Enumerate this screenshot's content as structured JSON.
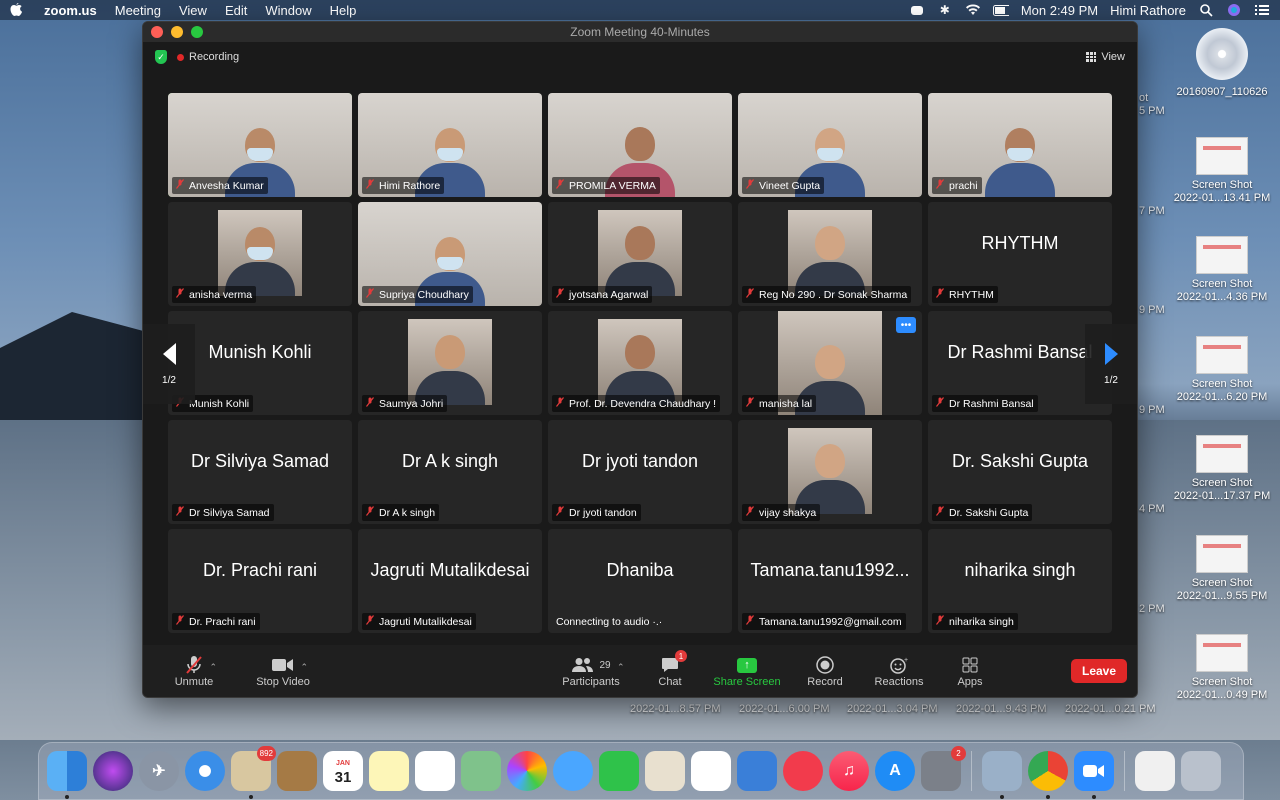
{
  "menubar": {
    "app": "zoom.us",
    "items": [
      "Meeting",
      "View",
      "Edit",
      "Window",
      "Help"
    ],
    "clock": "Mon 2:49 PM",
    "user": "Himi Rathore"
  },
  "window": {
    "title": "Zoom Meeting   40-Minutes",
    "recording": "Recording",
    "view_label": "View",
    "page_indicator": "1/2"
  },
  "participants": [
    {
      "name": "Anvesha Kumar",
      "display": "",
      "video": "masked",
      "active": true
    },
    {
      "name": "Himi Rathore",
      "display": "",
      "video": "masked",
      "active": false
    },
    {
      "name": "PROMILA VERMA",
      "display": "",
      "video": "person",
      "active": false
    },
    {
      "name": "Vineet Gupta",
      "display": "",
      "video": "masked",
      "active": false
    },
    {
      "name": "prachi",
      "display": "",
      "video": "masked",
      "active": false
    },
    {
      "name": "anisha verma",
      "display": "",
      "video": "photo-masked",
      "active": false
    },
    {
      "name": "Supriya Choudhary",
      "display": "",
      "video": "masked",
      "active": false
    },
    {
      "name": "jyotsana Agarwal",
      "display": "",
      "video": "photo",
      "active": false
    },
    {
      "name": "Reg No 290 . Dr Sonak Sharma",
      "display": "",
      "video": "photo",
      "active": false
    },
    {
      "name": "RHYTHM",
      "display": "RHYTHM",
      "video": "none",
      "active": false
    },
    {
      "name": "Munish Kohli",
      "display": "Munish Kohli",
      "video": "none",
      "active": false
    },
    {
      "name": "Saumya Johri",
      "display": "",
      "video": "photo",
      "active": false
    },
    {
      "name": "Prof. Dr. Devendra Chaudhary !",
      "display": "",
      "video": "photo",
      "active": false
    },
    {
      "name": "manisha lal",
      "display": "",
      "video": "photo-tall",
      "active": false,
      "more": "•••"
    },
    {
      "name": "Dr Rashmi Bansal",
      "display": "Dr Rashmi Bansal",
      "video": "none",
      "active": false
    },
    {
      "name": "Dr Silviya Samad",
      "display": "Dr Silviya Samad",
      "video": "none",
      "active": false
    },
    {
      "name": "Dr A k singh",
      "display": "Dr A k singh",
      "video": "none",
      "active": false
    },
    {
      "name": "Dr jyoti tandon",
      "display": "Dr jyoti tandon",
      "video": "none",
      "active": false
    },
    {
      "name": "vijay shakya",
      "display": "",
      "video": "photo",
      "active": false
    },
    {
      "name": "Dr. Sakshi Gupta",
      "display": "Dr. Sakshi Gupta",
      "video": "none",
      "active": false
    },
    {
      "name": "Dr. Prachi rani",
      "display": "Dr. Prachi rani",
      "video": "none",
      "active": false
    },
    {
      "name": "Jagruti Mutalikdesai",
      "display": "Jagruti Mutalikdesai",
      "video": "none",
      "active": false
    },
    {
      "name": "Connecting to audio  ·.·",
      "display": "Dhaniba",
      "video": "none",
      "active": false,
      "connecting": true
    },
    {
      "name": "Tamana.tanu1992@gmail.com",
      "display": "Tamana.tanu1992...",
      "video": "none",
      "active": false
    },
    {
      "name": "niharika singh",
      "display": "niharika singh",
      "video": "none",
      "active": false
    }
  ],
  "toolbar": {
    "unmute": "Unmute",
    "stop_video": "Stop Video",
    "participants": "Participants",
    "participants_count": "29",
    "chat": "Chat",
    "chat_badge": "1",
    "share_screen": "Share Screen",
    "record": "Record",
    "reactions": "Reactions",
    "apps": "Apps",
    "leave": "Leave"
  },
  "desktop": {
    "disc_label": "20160907_110626",
    "screenshots": [
      {
        "line1": "Screen Shot",
        "line2": "2022-01...13.41 PM"
      },
      {
        "line1": "Screen Shot",
        "line2": "2022-01...4.36 PM"
      },
      {
        "line1": "Screen Shot",
        "line2": "2022-01...6.20 PM"
      },
      {
        "line1": "Screen Shot",
        "line2": "2022-01...17.37 PM"
      },
      {
        "line1": "Screen Shot",
        "line2": "2022-01...9.55 PM"
      },
      {
        "line1": "Screen Shot",
        "line2": "2022-01...0.49 PM"
      }
    ],
    "bottom_labels": [
      "2022-01...8.57 PM",
      "2022-01...6.00 PM",
      "2022-01...3.04 PM",
      "2022-01...9.43 PM",
      "2022-01...0.21 PM"
    ],
    "peeks": [
      "ot",
      "5 PM",
      "7 PM",
      "9 PM",
      "9 PM",
      "4 PM",
      "2 PM"
    ]
  },
  "dock": {
    "mail_badge": "892",
    "calendar_month": "JAN",
    "calendar_day": "31",
    "settings_badge": "2"
  },
  "colors": {
    "accent_blue": "#2d8cff",
    "leave_red": "#e02828",
    "share_green": "#28c840",
    "active_border": "#7ad16b"
  }
}
